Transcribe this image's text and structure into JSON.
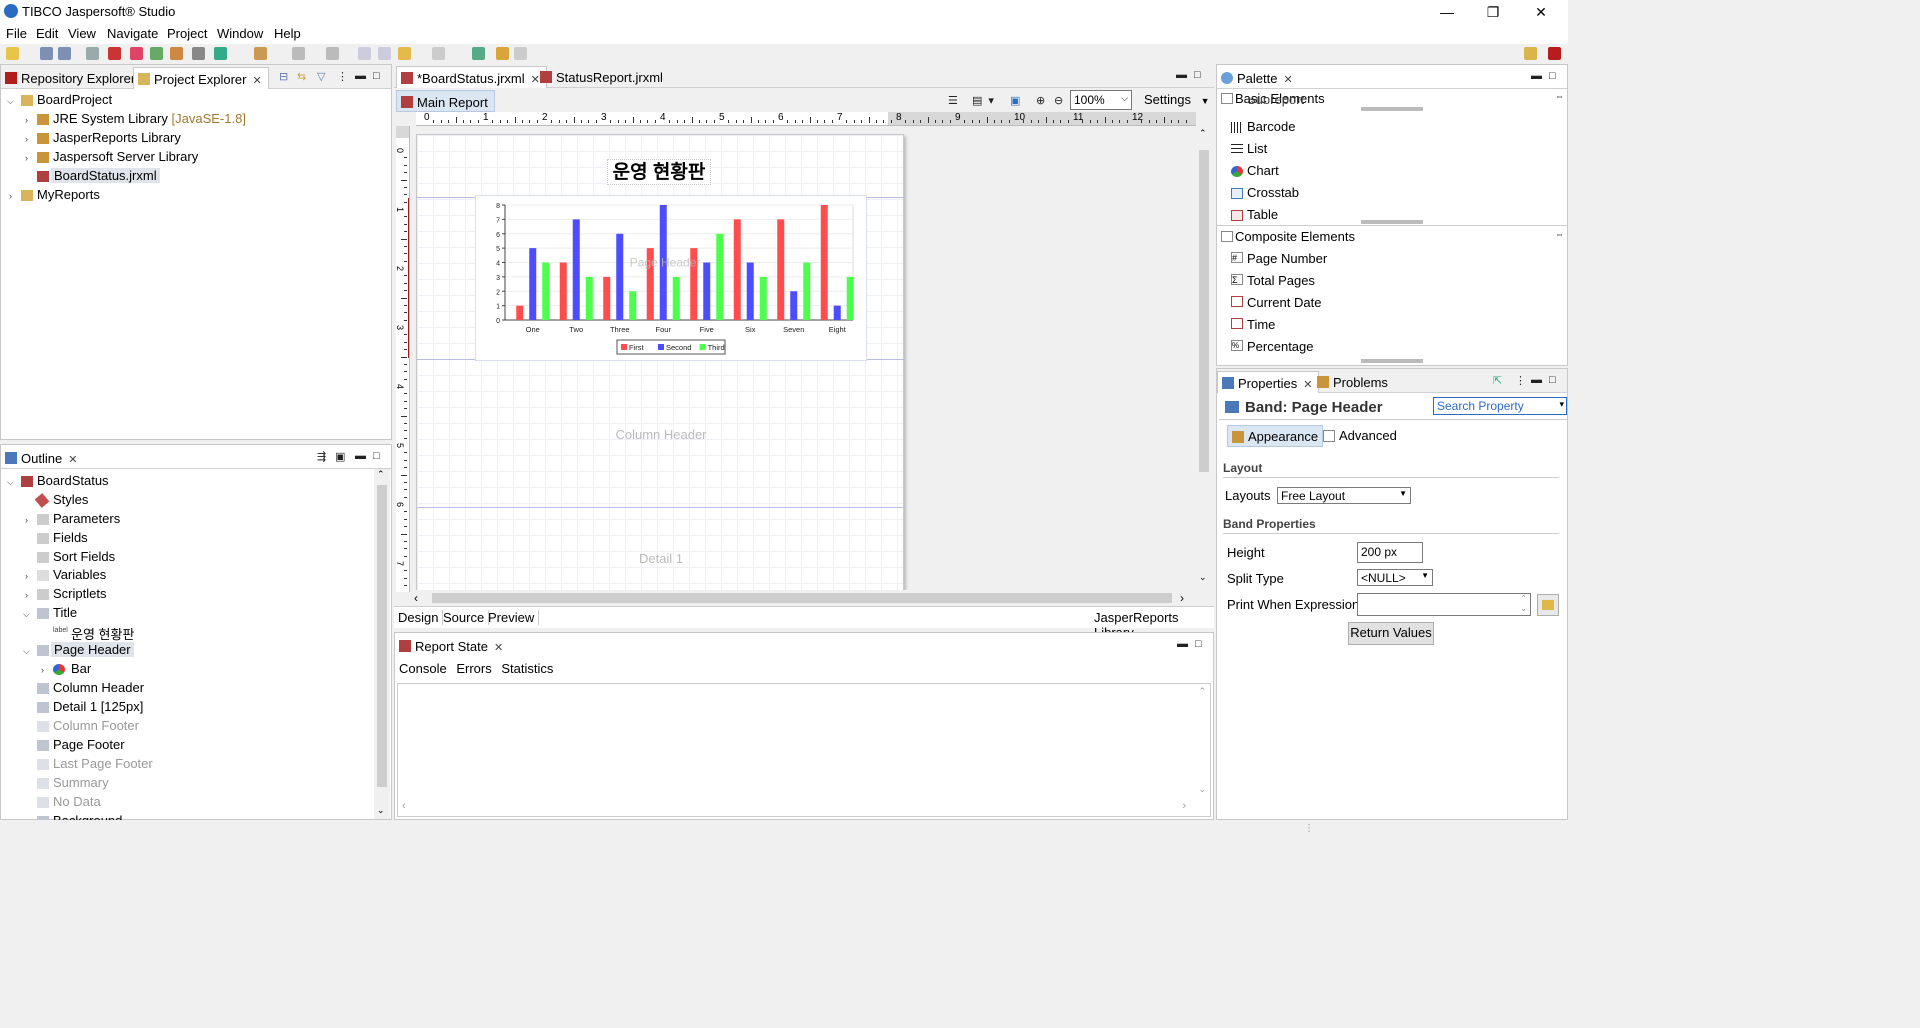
{
  "window": {
    "title": "TIBCO Jaspersoft® Studio",
    "min": "—",
    "max": "❐",
    "close": "✕"
  },
  "menu": [
    "File",
    "Edit",
    "View",
    "Navigate",
    "Project",
    "Window",
    "Help"
  ],
  "left_top": {
    "tabs": [
      "Repository Explorer",
      "Project Explorer"
    ],
    "tree": {
      "root": "BoardProject",
      "jre": "JRE System Library",
      "jre_tag": "[JavaSE-1.8]",
      "jasper_lib": "JasperReports Library",
      "server_lib": "Jaspersoft Server Library",
      "file": "BoardStatus.jrxml",
      "myreports": "MyReports"
    }
  },
  "outline": {
    "tab": "Outline",
    "items": {
      "root": "BoardStatus",
      "styles": "Styles",
      "parameters": "Parameters",
      "fields": "Fields",
      "sort_fields": "Sort Fields",
      "variables": "Variables",
      "scriptlets": "Scriptlets",
      "title": "Title",
      "label_tag": "label",
      "title_label": "운영 현황판",
      "page_header": "Page Header",
      "bar": "Bar",
      "column_header": "Column Header",
      "detail1": "Detail 1 [125px]",
      "column_footer": "Column Footer",
      "page_footer": "Page Footer",
      "last_page_footer": "Last Page Footer",
      "summary": "Summary",
      "no_data": "No Data",
      "background": "Background"
    }
  },
  "editor": {
    "tabs": [
      "*BoardStatus.jrxml",
      "StatusReport.jrxml"
    ],
    "subtab": "Main Report",
    "zoom": "100%",
    "settings": "Settings",
    "ruler_marks": [
      "0",
      "1",
      "2",
      "3",
      "4",
      "5",
      "6",
      "7",
      "8",
      "9",
      "10",
      "11",
      "12"
    ],
    "vruler_marks": [
      "0",
      "1",
      "2",
      "3",
      "4",
      "5",
      "6",
      "7"
    ],
    "bottom_tabs": [
      "Design",
      "Source",
      "Preview"
    ],
    "library": "JasperReports Library",
    "report_title": "운영 현황판",
    "bands": {
      "page_header": "Page Header",
      "column_header": "Column Header",
      "detail": "Detail 1"
    }
  },
  "chart_data": {
    "type": "bar",
    "categories": [
      "One",
      "Two",
      "Three",
      "Four",
      "Five",
      "Six",
      "Seven",
      "Eight"
    ],
    "series": [
      {
        "name": "First",
        "color": "#ff4d4d",
        "values": [
          1,
          4,
          3,
          5,
          5,
          7,
          7,
          8
        ]
      },
      {
        "name": "Second",
        "color": "#4d4dff",
        "values": [
          5,
          7,
          6,
          8,
          4,
          4,
          2,
          1
        ]
      },
      {
        "name": "Third",
        "color": "#4dff4d",
        "values": [
          4,
          3,
          2,
          3,
          6,
          3,
          4,
          3
        ]
      }
    ],
    "yticks": [
      "0",
      "1",
      "2",
      "3",
      "4",
      "5",
      "6",
      "7",
      "8"
    ],
    "ylim": [
      0,
      8
    ],
    "legend": "bottom"
  },
  "report_state": {
    "tab": "Report State",
    "subtabs": [
      "Console",
      "Errors",
      "Statistics"
    ]
  },
  "palette": {
    "tab": "Palette",
    "basic_header": "Basic Elements",
    "basic_partial": "Subreport",
    "basic": [
      "Barcode",
      "List",
      "Chart",
      "Crosstab",
      "Table"
    ],
    "composite_header": "Composite Elements",
    "composite": [
      "Page Number",
      "Total Pages",
      "Current Date",
      "Time",
      "Percentage"
    ]
  },
  "properties": {
    "tabs": [
      "Properties",
      "Problems"
    ],
    "title": "Band: Page Header",
    "search_placeholder": "Search Property",
    "subtabs": [
      "Appearance",
      "Advanced"
    ],
    "layout_section": "Layout",
    "layouts_label": "Layouts",
    "layouts_value": "Free Layout",
    "band_section": "Band Properties",
    "height_label": "Height",
    "height_value": "200 px",
    "split_label": "Split Type",
    "split_value": "<NULL>",
    "print_label": "Print When Expression",
    "print_value": "",
    "return_values": "Return Values"
  }
}
